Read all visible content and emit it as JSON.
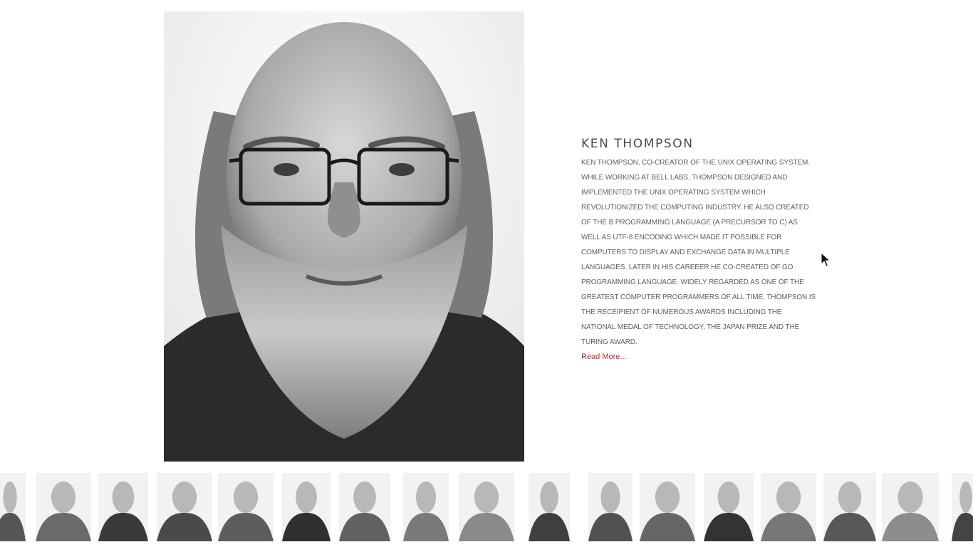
{
  "featured": {
    "name": "KEN THOMPSON",
    "bio": "KEN THOMPSON, CO-CREATOR OF THE UNIX OPERATING SYSTEM. WHILE WORKING AT BELL LABS, THOMPSON DESIGNED AND IMPLEMENTED THE UNIX OPERATING SYSTEM WHICH REVOLUTIONIZED THE COMPUTING INDUSTRY. HE ALSO CREATED OF THE B PROGRAMMING LANGUAGE (A PRECURSOR TO C) AS WELL AS UTF-8 ENCODING WHICH MADE IT POSSIBLE FOR COMPUTERS TO DISPLAY AND EXCHANGE DATA IN MULTIPLE LANGUAGES. LATER IN HIS CAREEER HE CO-CREATED OF GO PROGRAMMING LANGUAGE. WIDELY REGARDED AS ONE OF THE GREATEST COMPUTER PROGRAMMERS OF ALL TIME, THOMPSON IS THE RECEIPIENT OF NUMEROUS AWARDS INCLUDING THE NATIONAL MEDAL OF TECHNOLOGY, THE JAPAN PRIZE AND THE TURING AWARD.",
    "read_more_label": "Read More..."
  },
  "colors": {
    "accent": "#c8262c",
    "heading": "#4a4a4a",
    "body_text": "#606060",
    "background": "#ffffff"
  },
  "icons": {
    "cursor": "mouse-pointer-icon"
  }
}
